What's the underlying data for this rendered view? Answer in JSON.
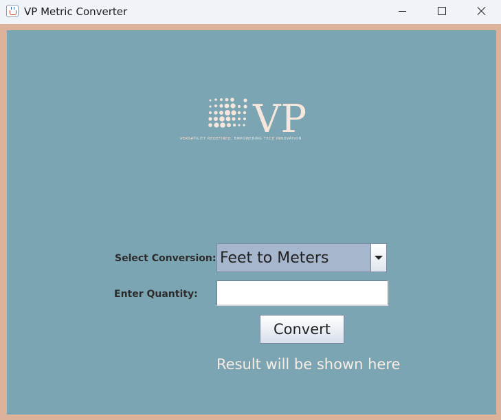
{
  "window": {
    "title": "VP Metric Converter",
    "icon": "java-cup-icon"
  },
  "titlebar_buttons": {
    "minimize": "minimize-icon",
    "maximize": "maximize-icon",
    "close": "close-icon"
  },
  "logo": {
    "text": "VP",
    "tagline": "VERSATILITY REDEFINED, EMPOWERING TECH INNOVATION"
  },
  "form": {
    "conversion_label": "Select Conversion:",
    "conversion_selected": "Feet to Meters",
    "quantity_label": "Enter Quantity:",
    "quantity_value": "",
    "convert_label": "Convert",
    "result_text": "Result will be shown here"
  },
  "colors": {
    "frame": "#dcb29a",
    "panel": "#7ca5b3",
    "logo": "#f6e6dc"
  }
}
